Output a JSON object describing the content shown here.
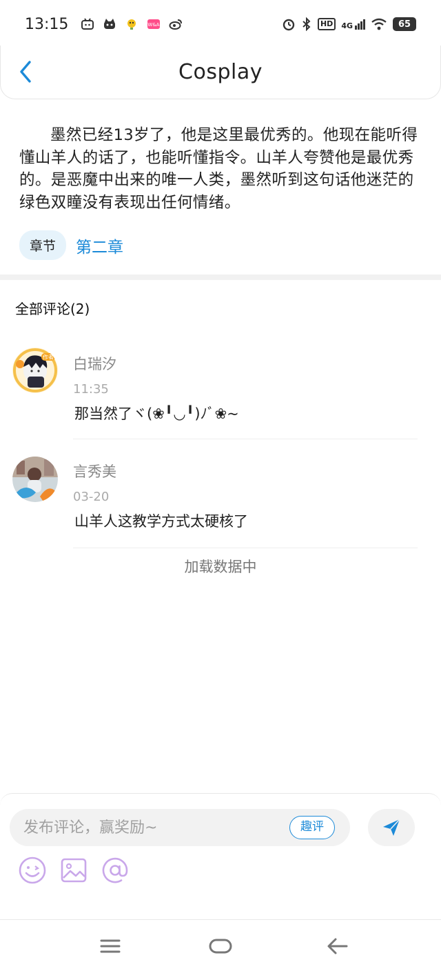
{
  "status_bar": {
    "time": "13:15",
    "network": "4G",
    "hd": "HD",
    "battery": "65",
    "icons": [
      "bilibili-icon",
      "cat-icon",
      "bird-icon",
      "app-icon",
      "weibo-icon",
      "alarm-icon",
      "bluetooth-icon",
      "wifi-icon"
    ]
  },
  "header": {
    "title": "Cosplay",
    "back_icon": "chevron-left-icon",
    "accent_color": "#1c8ad8"
  },
  "article": {
    "text": "墨然已经13岁了，他是这里最优秀的。他现在能听得懂山羊人的话了，也能听懂指令。山羊人夸赞他是最优秀的。是恶魔中出来的唯一人类，墨然听到这句话他迷茫的绿色双瞳没有表现出任何情绪。",
    "chapter_tag": "章节",
    "chapter_link": "第二章"
  },
  "comments": {
    "title": "全部评论(2)",
    "items": [
      {
        "name": "白瑞汐",
        "time": "11:35",
        "text": "那当然了ヾ(❀╹◡╹)ﾉﾞ❀~",
        "avatar_badge": "作者"
      },
      {
        "name": "言秀美",
        "time": "03-20",
        "text": "山羊人这教学方式太硬核了"
      }
    ],
    "loading": "加载数据中"
  },
  "composer": {
    "placeholder": "发布评论，赢奖励~",
    "quping_label": "趣评",
    "send_icon": "send-icon",
    "tools": [
      "emoji-icon",
      "image-icon",
      "at-icon"
    ],
    "tool_color": "#c9a7ea"
  },
  "navbar": {
    "buttons": [
      "menu-icon",
      "home-icon",
      "back-icon"
    ]
  }
}
